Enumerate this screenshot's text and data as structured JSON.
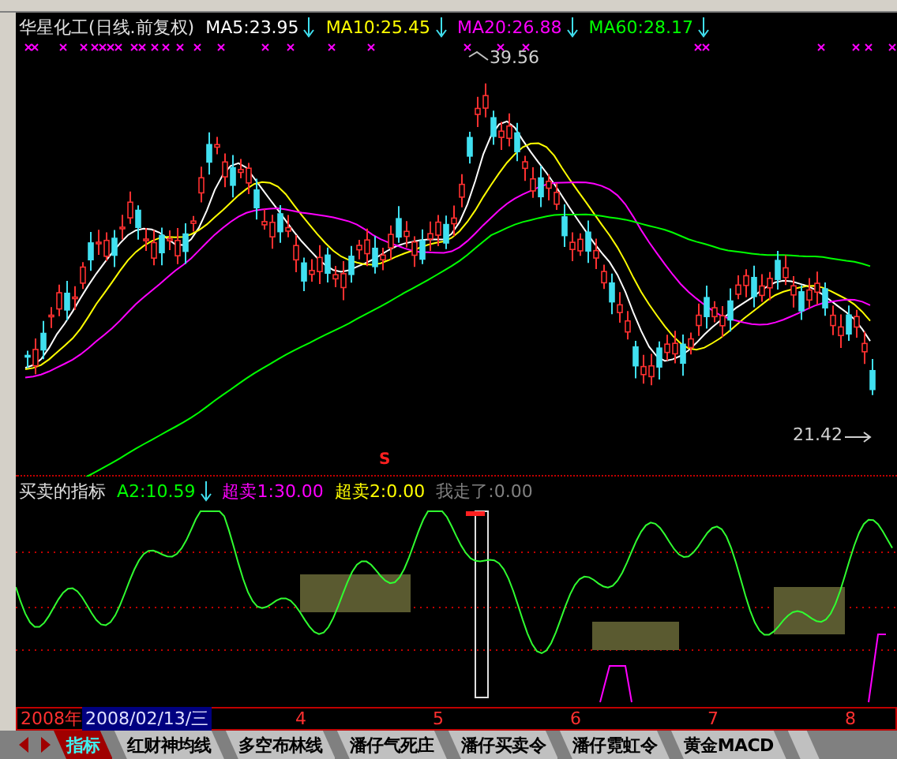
{
  "stock_chart": {
    "title": "华星化工(日线.前复权)",
    "ma_legend": [
      {
        "label": "MA5:23.95",
        "color": "#ffffff",
        "arrow": true
      },
      {
        "label": "MA10:25.45",
        "color": "#ffff00",
        "arrow": true
      },
      {
        "label": "MA20:26.88",
        "color": "#ff00ff",
        "arrow": true
      },
      {
        "label": "MA60:28.17",
        "color": "#00ff00",
        "arrow": true
      }
    ],
    "high_label": "39.56",
    "low_label": "21.42",
    "signal_mark": "S"
  },
  "indicator": {
    "name": "买卖的指标",
    "values": [
      {
        "label": "A2:10.59",
        "color": "#00ff00",
        "arrow": true
      },
      {
        "label": "超卖1:30.00",
        "color": "#ff00ff",
        "arrow": false
      },
      {
        "label": "超卖2:0.00",
        "color": "#ffff00",
        "arrow": false
      },
      {
        "label": "我走了:0.00",
        "color": "#808080",
        "arrow": false
      }
    ]
  },
  "time_axis": {
    "year": "2008年",
    "cursor_date": "2008/02/13/三",
    "months": [
      "4",
      "5",
      "6",
      "7",
      "8"
    ]
  },
  "tabs": [
    {
      "label": "指标",
      "selected": true
    },
    {
      "label": "红财神均线",
      "selected": false
    },
    {
      "label": "多空布林线",
      "selected": false
    },
    {
      "label": "潘仔气死庄",
      "selected": false
    },
    {
      "label": "潘仔买卖令",
      "selected": false
    },
    {
      "label": "潘仔霓虹令",
      "selected": false
    },
    {
      "label": "黄金MACD",
      "selected": false
    }
  ]
}
